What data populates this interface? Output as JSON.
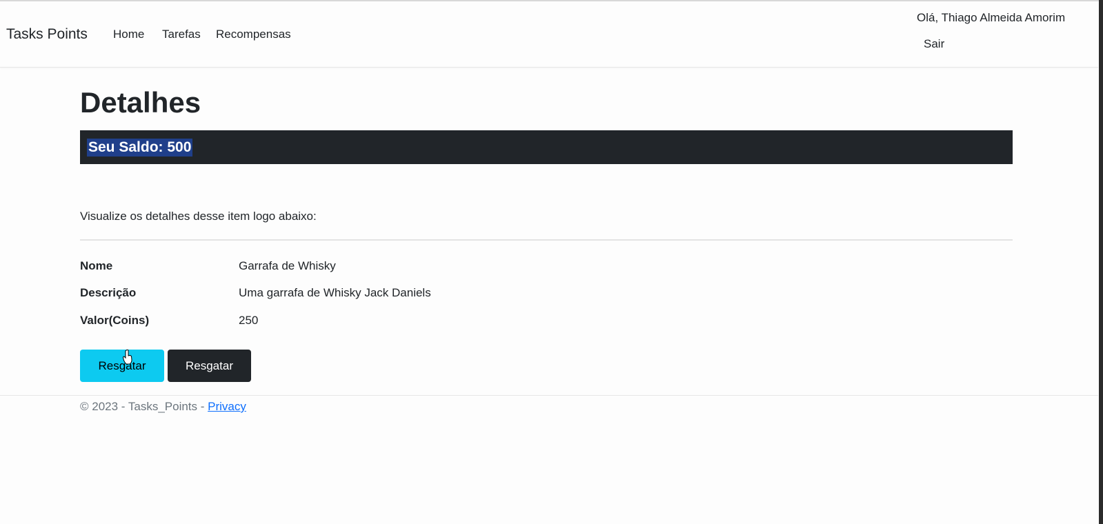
{
  "navbar": {
    "brand": "Tasks Points",
    "links": [
      "Home",
      "Tarefas",
      "Recompensas"
    ],
    "greeting": "Olá, Thiago Almeida Amorim",
    "logout": "Sair"
  },
  "main": {
    "title": "Detalhes",
    "balance": "Seu Saldo: 500",
    "intro": "Visualize os detalhes desse item logo abaixo:",
    "details": [
      {
        "term": "Nome",
        "value": "Garrafa de Whisky"
      },
      {
        "term": "Descrição",
        "value": "Uma garrafa de Whisky Jack Daniels"
      },
      {
        "term": "Valor(Coins)",
        "value": "250"
      }
    ],
    "buttons": {
      "redeem_info": "Resgatar",
      "redeem_dark": "Resgatar"
    }
  },
  "footer": {
    "text": "© 2023 - Tasks_Points - ",
    "link": "Privacy"
  },
  "colors": {
    "info": "#0dcaf0",
    "dark": "#212529",
    "selection": "#1f3f8a",
    "link": "#0d6efd"
  },
  "icons": {
    "cursor": "hand-pointer-icon"
  }
}
